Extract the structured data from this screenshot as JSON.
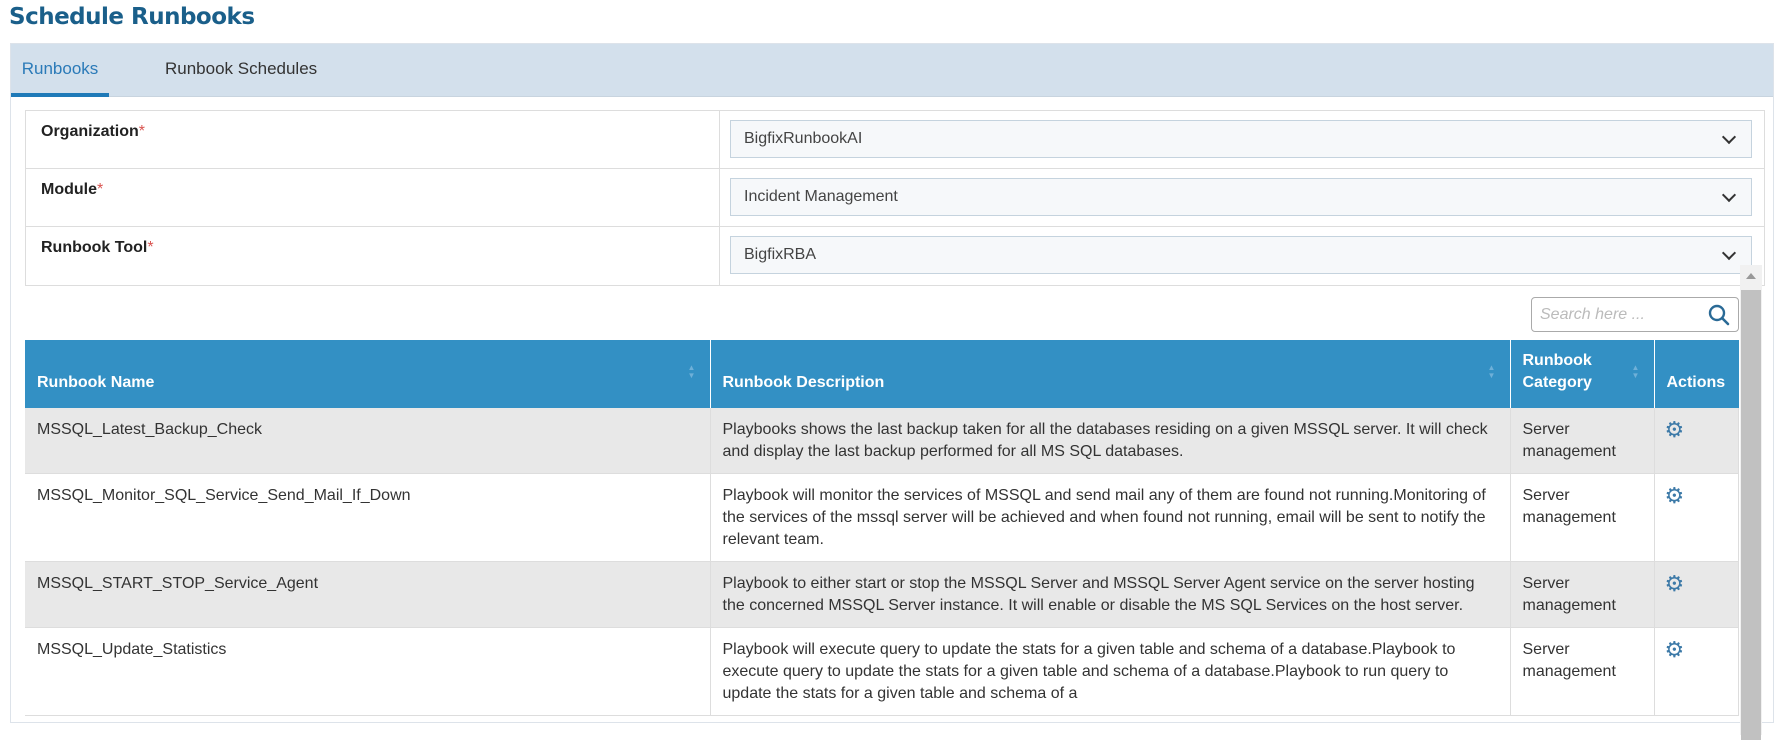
{
  "page_title": "Schedule Runbooks",
  "tabs": [
    {
      "label": "Runbooks",
      "active": true
    },
    {
      "label": "Runbook Schedules",
      "active": false
    }
  ],
  "form": {
    "organization": {
      "label": "Organization",
      "required": "*",
      "value": "BigfixRunbookAI"
    },
    "module": {
      "label": "Module",
      "required": "*",
      "value": "Incident Management"
    },
    "runbook_tool": {
      "label": "Runbook Tool",
      "required": "*",
      "value": "BigfixRBA"
    }
  },
  "search": {
    "placeholder": "Search here ..."
  },
  "table": {
    "headers": [
      "Runbook Name",
      "Runbook Description",
      "Runbook Category",
      "Actions"
    ],
    "rows": [
      {
        "name": "MSSQL_Latest_Backup_Check",
        "description": "Playbooks shows the last backup taken for all the databases residing on a given MSSQL server. It will check and display the last backup performed for all MS SQL databases.",
        "category": "Server management"
      },
      {
        "name": "MSSQL_Monitor_SQL_Service_Send_Mail_If_Down",
        "description": "Playbook will monitor the services of MSSQL and send mail any of them are found not running.Monitoring of the services of the mssql server will be achieved and when found not running, email will be sent to notify the relevant team.",
        "category": "Server management"
      },
      {
        "name": "MSSQL_START_STOP_Service_Agent",
        "description": "Playbook to either start or stop the MSSQL Server and MSSQL Server Agent service on the server hosting the concerned MSSQL Server instance. It will enable or disable the MS SQL Services on the host server.",
        "category": "Server management"
      },
      {
        "name": "MSSQL_Update_Statistics",
        "description": "Playbook will execute query to update the stats for a given table and schema of a database.Playbook to execute query to update the stats for a given table and schema of a database.Playbook to run query to update the stats for a given table and schema of a",
        "category": "Server management"
      }
    ]
  },
  "colors": {
    "header": "#3390c4",
    "title": "#1a5f8a",
    "tabbar": "#d3e0ec",
    "required": "#d9534f"
  }
}
